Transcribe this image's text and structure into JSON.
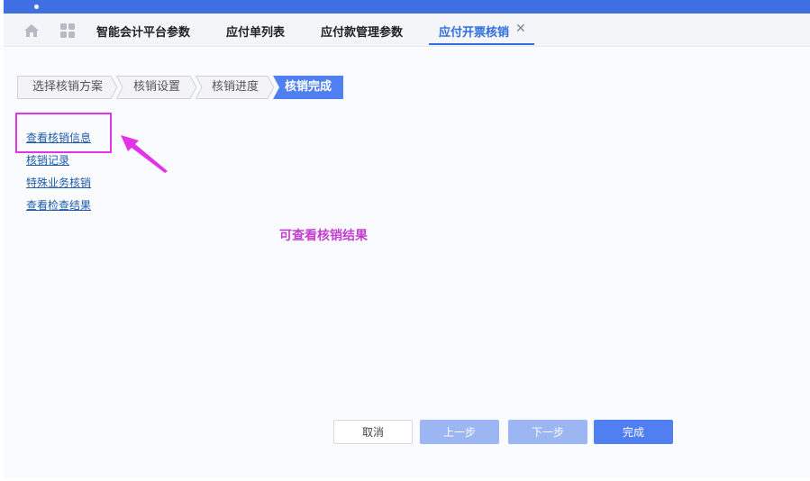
{
  "tabs": [
    {
      "label": "智能会计平台参数"
    },
    {
      "label": "应付单列表"
    },
    {
      "label": "应付款管理参数"
    },
    {
      "label": "应付开票核销",
      "active": true
    }
  ],
  "tab_close_glyph": "✕",
  "icons": {
    "home": "home-icon",
    "apps": "grid-icon",
    "close": "close-icon"
  },
  "steps": [
    {
      "label": "选择核销方案"
    },
    {
      "label": "核销设置"
    },
    {
      "label": "核销进度"
    },
    {
      "label": "核销完成",
      "active": true
    }
  ],
  "links": [
    {
      "label": "查看核销信息"
    },
    {
      "label": "核销记录"
    },
    {
      "label": "特殊业务核销"
    },
    {
      "label": "查看检查结果"
    }
  ],
  "annotation": {
    "text": "可查看核销结果",
    "color": "#e233e6"
  },
  "buttons": {
    "cancel": "取消",
    "prev": "上一步",
    "next": "下一步",
    "finish": "完成"
  },
  "colors": {
    "accent": "#2f6fe0",
    "topbar": "#3f6fe3",
    "step_active": "#4f7ff0",
    "button_disabled": "#9bb6f2"
  }
}
